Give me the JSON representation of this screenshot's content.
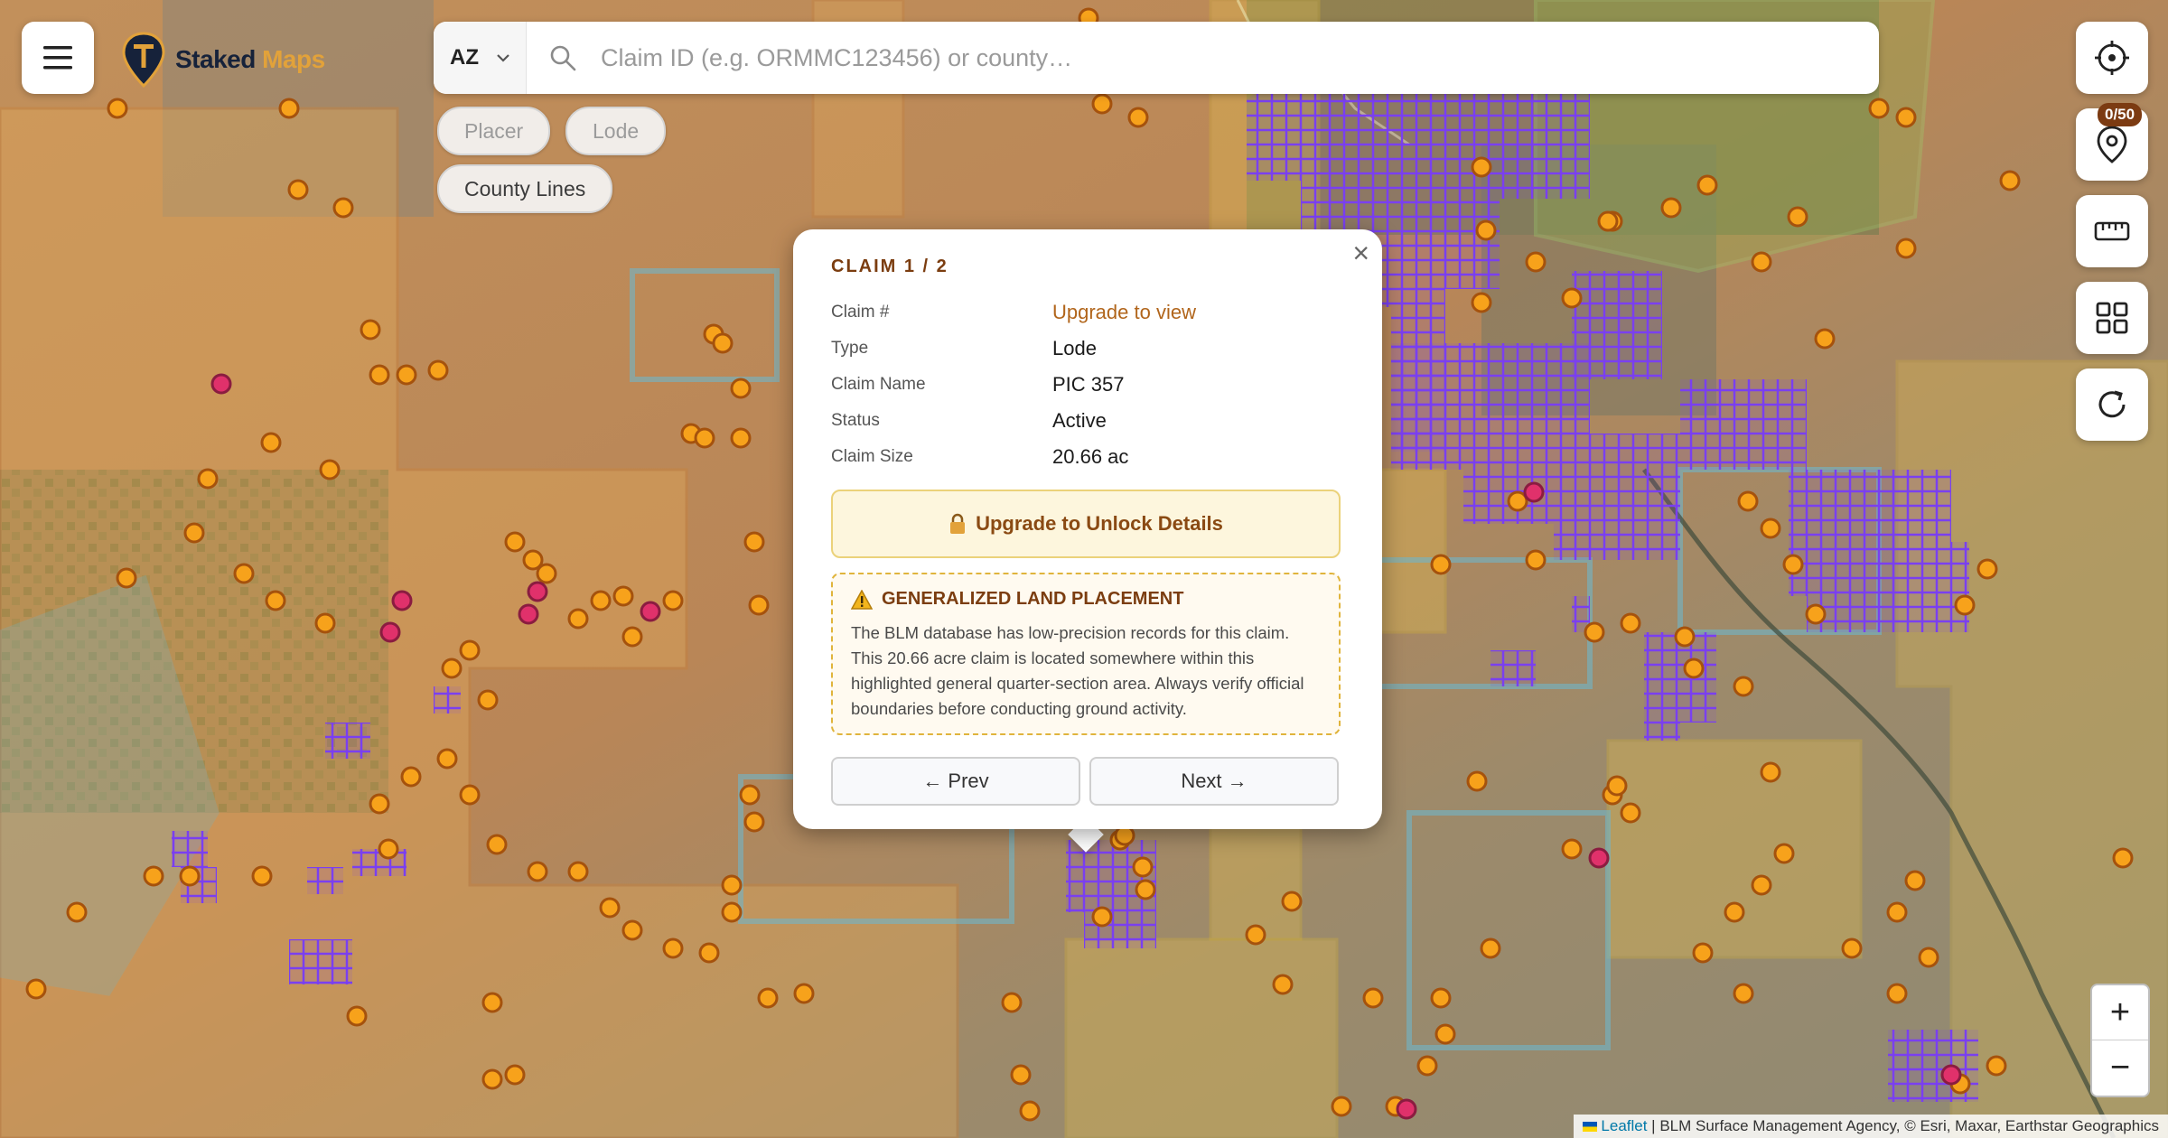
{
  "header": {
    "brand_part1": "Staked",
    "brand_part2": "Maps"
  },
  "search": {
    "state": "AZ",
    "placeholder": "Claim ID (e.g. ORMMC123456) or county…"
  },
  "filters": {
    "chips": [
      {
        "label": "Placer",
        "active": false
      },
      {
        "label": "Lode",
        "active": false
      },
      {
        "label": "County Lines",
        "active": true
      }
    ]
  },
  "tools": {
    "pin_badge": "0/50"
  },
  "popup": {
    "title": "CLAIM 1 / 2",
    "rows": [
      {
        "key": "Claim #",
        "value": "Upgrade to view"
      },
      {
        "key": "Type",
        "value": "Lode"
      },
      {
        "key": "Claim Name",
        "value": "PIC 357"
      },
      {
        "key": "Status",
        "value": "Active"
      },
      {
        "key": "Claim Size",
        "value": "20.66 ac"
      }
    ],
    "upgrade_label": "Upgrade to Unlock Details",
    "warning_title": "GENERALIZED LAND PLACEMENT",
    "warning_text": "The BLM database has low-precision records for this claim. This 20.66 acre claim is located somewhere within this highlighted general quarter-section area. Always verify official boundaries before conducting ground activity.",
    "prev_label": "← Prev",
    "next_label": "Next →"
  },
  "zoom": {
    "in": "+",
    "out": "−"
  },
  "attribution": {
    "leaflet": "Leaflet",
    "rest": " | BLM Surface Management Agency, © Esri, Maxar, Earthstar Geographics"
  },
  "colors": {
    "claim_polygon": "#7a3ff0",
    "placer_marker": "#f7a21b",
    "active_marker": "#e0316b",
    "blm_land": "#e0a85a",
    "state_land": "#6fb5c9",
    "accent_brown": "#7b3d10"
  }
}
